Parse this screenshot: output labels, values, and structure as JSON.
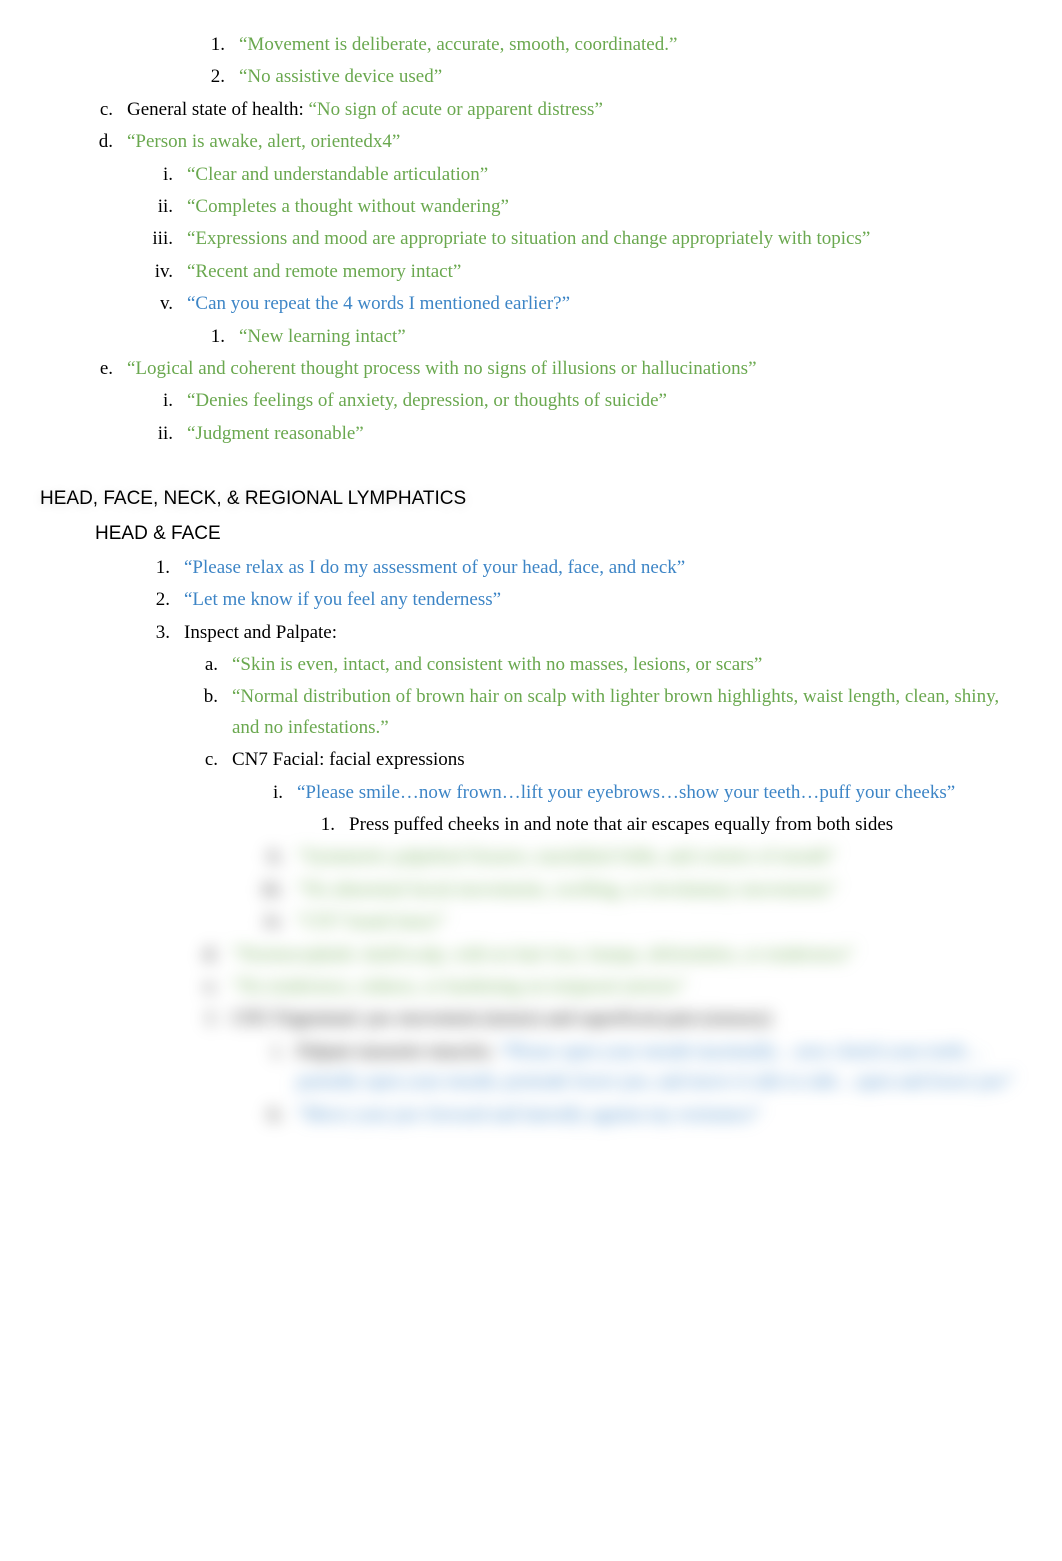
{
  "top": {
    "movement_num": "1.",
    "movement": "“Movement is deliberate, accurate, smooth, coordinated.”",
    "assistive_num": "2.",
    "assistive": "“No assistive device used”",
    "c_marker": "c.",
    "c_label": "General state of health: ",
    "c_text": "“No sign of acute or apparent distress”",
    "d_marker": "d.",
    "d_text": "“Person is awake, alert, orientedx4”",
    "d_i_marker": "i.",
    "d_i": "“Clear and understandable articulation”",
    "d_ii_marker": "ii.",
    "d_ii": "“Completes a thought without wandering”",
    "d_iii_marker": "iii.",
    "d_iii": "“Expressions and mood are appropriate to situation and change appropriately with topics”",
    "d_iv_marker": "iv.",
    "d_iv": "“Recent and remote memory intact”",
    "d_v_marker": "v.",
    "d_v": "“Can you repeat the 4 words I mentioned earlier?”",
    "d_v_1_marker": "1.",
    "d_v_1": "“New learning intact”",
    "e_marker": "e.",
    "e_text": "“Logical and coherent thought process with no signs of illusions or hallucinations”",
    "e_i_marker": "i.",
    "e_i": "“Denies feelings of anxiety, depression, or thoughts of suicide”",
    "e_ii_marker": "ii.",
    "e_ii": "“Judgment reasonable”"
  },
  "section": {
    "header": "HEAD, FACE, NECK, & REGIONAL LYMPHATICS",
    "subheader": "HEAD & FACE",
    "n1_marker": "1.",
    "n1": "“Please relax as I do my assessment of your head, face, and neck”",
    "n2_marker": "2.",
    "n2": "“Let me know if you feel any tenderness”",
    "n3_marker": "3.",
    "n3": "Inspect and Palpate:",
    "a_marker": "a.",
    "a": "“Skin is even, intact, and consistent with no masses, lesions, or scars”",
    "b_marker": "b.",
    "b": "“Normal distribution of brown hair on scalp with lighter brown highlights, waist length, clean, shiny, and no infestations.”",
    "c_marker": "c.",
    "c": "CN7 Facial: facial expressions",
    "c_i_marker": "i.",
    "c_i": "“Please smile…now frown…lift your eyebrows…show your teeth…puff your cheeks”",
    "c_i_1_marker": "1.",
    "c_i_1": "Press puffed cheeks in and note that air escapes equally from both sides",
    "c_ii_marker": "ii.",
    "c_ii": "“Symmetric palpebral fissures, nasolabial folds, and corners of mouth”",
    "c_iii_marker": "iii.",
    "c_iii": "“No abnormal facial movements, swelling, or involuntary movements”",
    "c_iv_marker": "iv.",
    "c_iv": "“CN7 found intact”",
    "d_marker": "d.",
    "d": "“Normocephalic skull/scalp, with no hair loss, bumps, deformities, or tenderness”",
    "e_marker": "e.",
    "e": "“No tenderness, redness, or hardening on temporal arteries”",
    "f_marker": "f.",
    "f": "CN5 Trigeminal: jaw movement (motor) and superficial pain (sensory)",
    "f_i_marker": "i.",
    "f_i_label": "Palpate masseter muscles. ",
    "f_i": "“Please open your mouth maximally…now clench your teeth… partially open your mouth, protrude lower jaw, and move it side to side…open and lower jaw”",
    "f_ii_marker": "ii.",
    "f_ii": "“Move your jaw forward and laterally against my resistance”"
  }
}
